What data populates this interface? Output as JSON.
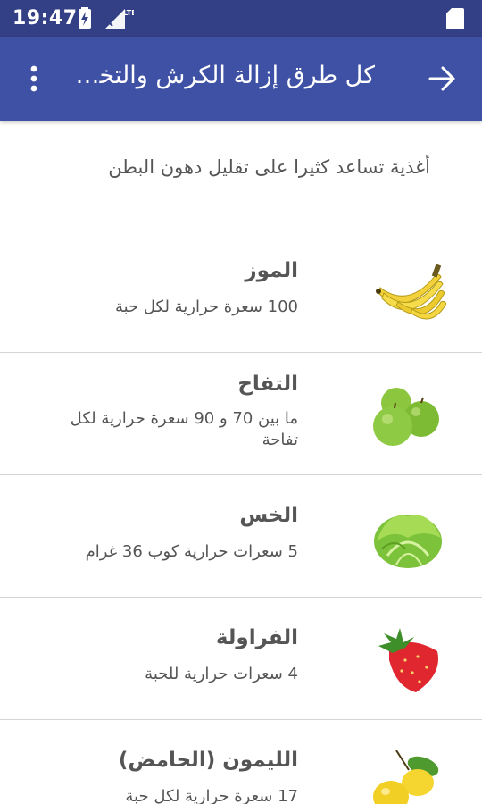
{
  "status_bar": {
    "time": "19:47",
    "network": "LTE"
  },
  "app_bar": {
    "title": "كل طرق إزالة الكرش والتخلص من دهون البطن",
    "back_icon": "arrow-right-icon",
    "menu_icon": "more-vert-icon"
  },
  "intro": "أغذية تساعد كثيرا على تقليل دهون البطن",
  "items": [
    {
      "name": "الموز",
      "desc": "100 سعرة حرارية لكل حبة",
      "icon": "banana-icon"
    },
    {
      "name": "التفاح",
      "desc": "ما بين 70 و 90 سعرة حرارية لكل تفاحة",
      "icon": "apple-icon"
    },
    {
      "name": "الخس",
      "desc": "5 سعرات حرارية كوب 36  غرام",
      "icon": "lettuce-icon"
    },
    {
      "name": "الفراولة",
      "desc": "4 سعرات حرارية للحبة",
      "icon": "strawberry-icon"
    },
    {
      "name": "الليمون (الحامض)",
      "desc": "17 سعرة حرارية لكل حبة",
      "icon": "lemon-icon"
    }
  ],
  "colors": {
    "status_bar": "#344085",
    "app_bar": "#3F51A5",
    "divider": "#d4d4d4",
    "text": "#555555"
  }
}
